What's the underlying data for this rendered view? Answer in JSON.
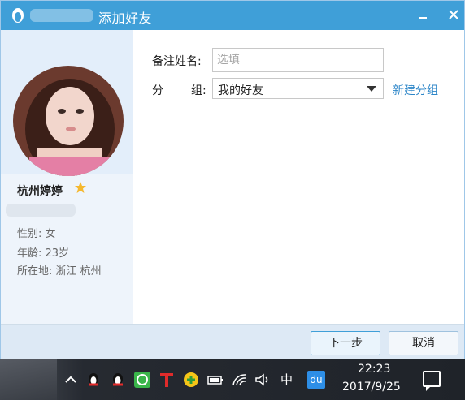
{
  "window": {
    "title": "添加好友",
    "minimize_icon": "minimize-icon",
    "close_icon": "close-icon",
    "logo_icon": "qq-penguin-icon",
    "accent_color": "#3f9fd8"
  },
  "profile": {
    "name": "杭州婷婷",
    "star_icon": "star-icon",
    "gender": "性别: 女",
    "age": "年龄: 23岁",
    "location": "所在地: 浙江  杭州"
  },
  "form": {
    "remark_label": "备注姓名:",
    "remark_placeholder": "选填",
    "remark_value": "",
    "group_label_first": "分",
    "group_label_second": "组:",
    "group_selected": "我的好友",
    "new_group_link": "新建分组"
  },
  "footer": {
    "next_label": "下一步",
    "cancel_label": "取消"
  },
  "taskbar": {
    "ime_label": "中",
    "tray_du_label": "du",
    "time": "22:23",
    "date": "2017/9/25",
    "tray_icons": [
      "show-hidden-icon",
      "qq-icon",
      "qq-icon",
      "chat-app-icon",
      "t-app-icon",
      "security-icon",
      "battery-icon",
      "wifi-icon",
      "volume-icon",
      "baidu-icon",
      "notification-icon"
    ]
  }
}
